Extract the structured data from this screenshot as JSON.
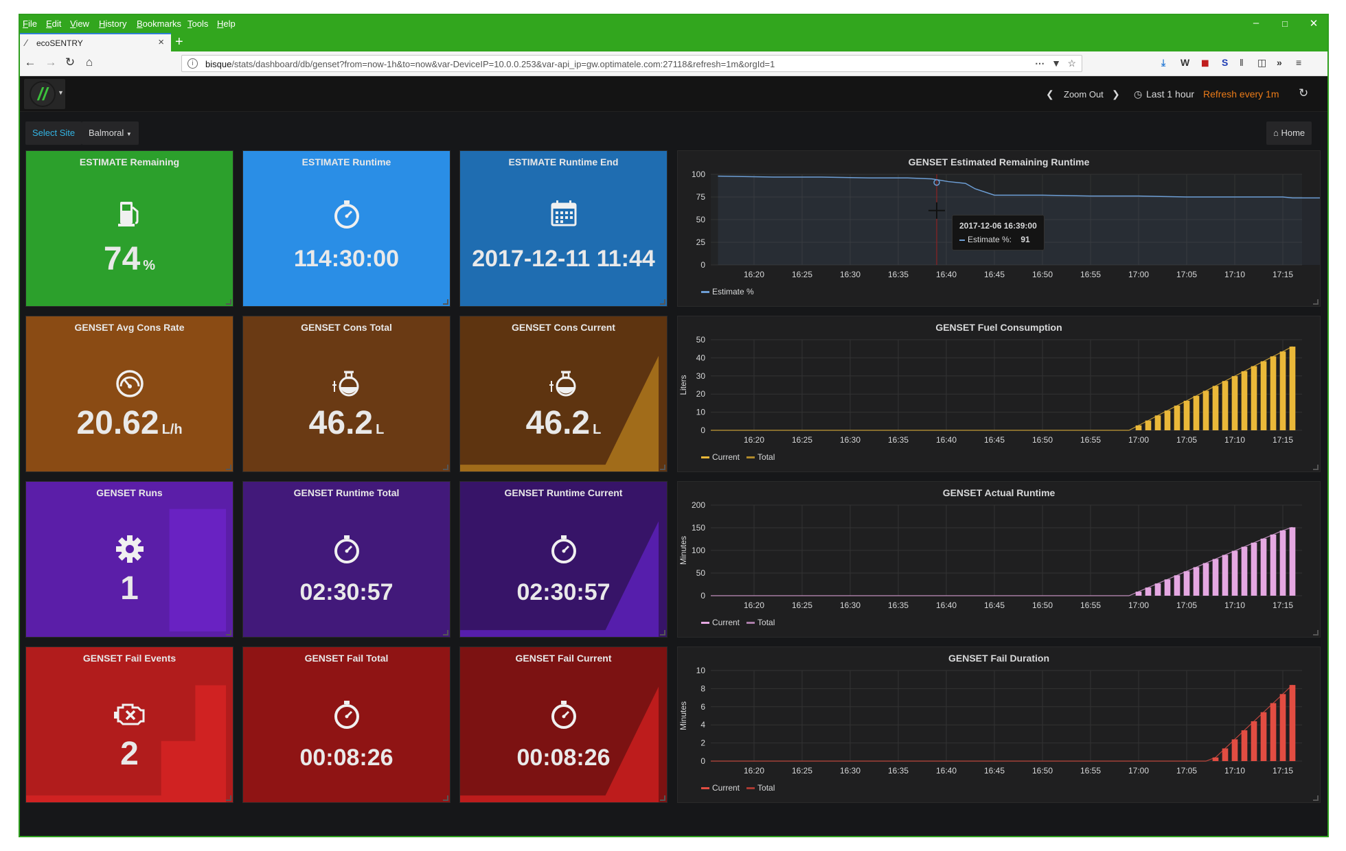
{
  "browser": {
    "menu": [
      "File",
      "Edit",
      "View",
      "History",
      "Bookmarks",
      "Tools",
      "Help"
    ],
    "tab_title": "ecoSENTRY",
    "url_host": "bisque",
    "url_path": "/stats/dashboard/db/genset?from=now-1h&to=now&var-DeviceIP=10.0.0.253&var-api_ip=gw.optimatele.com:27118&refresh=1m&orgId=1",
    "colors": {
      "frame": "#32a61e"
    }
  },
  "topbar": {
    "zoom_out": "Zoom Out",
    "time_range": "Last 1 hour",
    "refresh": "Refresh every 1m"
  },
  "vars": {
    "label": "Select Site",
    "value": "Balmoral",
    "home": "Home"
  },
  "stat_panels": [
    {
      "title": "ESTIMATE Remaining",
      "value": "74",
      "unit": "%",
      "icon": "fuel-pump-icon",
      "color": "#2ca02c",
      "spark": "none"
    },
    {
      "title": "ESTIMATE Runtime",
      "value": "114:30:00",
      "unit": "",
      "icon": "stopwatch-icon",
      "color": "#2a8ee6",
      "spark": "none"
    },
    {
      "title": "ESTIMATE Runtime End",
      "value": "2017-12-11 11:44",
      "unit": "",
      "icon": "calendar-icon",
      "color": "#1f6db1",
      "spark": "none"
    },
    {
      "title": "GENSET Avg Cons Rate",
      "value": "20.62",
      "unit": "L/h",
      "icon": "gauge-icon",
      "color": "#8a4b14",
      "spark": "none"
    },
    {
      "title": "GENSET Cons Total",
      "value": "46.2",
      "unit": "L",
      "icon": "flask-icon",
      "color": "#6a3a14",
      "spark": "none"
    },
    {
      "title": "GENSET Cons Current",
      "value": "46.2",
      "unit": "L",
      "icon": "flask-icon",
      "color": "#5e3410",
      "spark": "ramp",
      "spark_color": "#a8721c"
    },
    {
      "title": "GENSET Runs",
      "value": "1",
      "unit": "",
      "icon": "gear-icon",
      "color": "#5b1ea8",
      "spark": "block",
      "spark_color": "#6a22c4"
    },
    {
      "title": "GENSET Runtime Total",
      "value": "02:30:57",
      "unit": "",
      "icon": "stopwatch-icon",
      "color": "#42197a",
      "spark": "none"
    },
    {
      "title": "GENSET Runtime Current",
      "value": "02:30:57",
      "unit": "",
      "icon": "stopwatch-icon",
      "color": "#371468",
      "spark": "ramp",
      "spark_color": "#5a1fb4"
    },
    {
      "title": "GENSET Fail Events",
      "value": "2",
      "unit": "",
      "icon": "engine-icon",
      "color": "#b11c1c",
      "spark": "step",
      "spark_color": "#d42424"
    },
    {
      "title": "GENSET Fail Total",
      "value": "00:08:26",
      "unit": "",
      "icon": "stopwatch-icon",
      "color": "#8f1414",
      "spark": "none"
    },
    {
      "title": "GENSET Fail Current",
      "value": "00:08:26",
      "unit": "",
      "icon": "stopwatch-icon",
      "color": "#7c1212",
      "spark": "ramp",
      "spark_color": "#c41e1e"
    }
  ],
  "chart_data": [
    {
      "type": "line",
      "title": "GENSET Estimated Remaining Runtime",
      "xlabel": "",
      "ylabel": "",
      "xticks": [
        "16:20",
        "16:25",
        "16:30",
        "16:35",
        "16:40",
        "16:45",
        "16:50",
        "16:55",
        "17:00",
        "17:05",
        "17:10",
        "17:15"
      ],
      "ylim": [
        0,
        100
      ],
      "yticks": [
        0,
        25,
        50,
        75,
        100
      ],
      "color": "#6d9ed5",
      "fill": true,
      "series": [
        {
          "name": "Estimate %",
          "x": [
            16.25,
            22,
            27,
            32,
            36,
            38.5,
            40.2,
            42,
            43,
            45,
            50,
            55,
            60,
            65,
            70,
            75,
            76,
            80,
            85,
            90,
            91.5
          ],
          "values": [
            98,
            97,
            97,
            96,
            96,
            95,
            92,
            90,
            84,
            77,
            77,
            76,
            76,
            75,
            75,
            75,
            74,
            74,
            74,
            74,
            74
          ]
        }
      ],
      "tooltip": {
        "time": "2017-12-06 16:39:00",
        "label": "Estimate %:",
        "value": "91"
      }
    },
    {
      "type": "bar",
      "title": "GENSET Fuel Consumption",
      "xlabel": "",
      "ylabel": "Liters",
      "xticks": [
        "16:20",
        "16:25",
        "16:30",
        "16:35",
        "16:40",
        "16:45",
        "16:50",
        "16:55",
        "17:00",
        "17:05",
        "17:10",
        "17:15"
      ],
      "ylim": [
        0,
        50
      ],
      "yticks": [
        0,
        10,
        20,
        30,
        40,
        50
      ],
      "color": "#eab839",
      "series": [
        {
          "name": "Current",
          "x": [
            60,
            61,
            62,
            63,
            64,
            65,
            66,
            67,
            68,
            69,
            70,
            71,
            72,
            73,
            74,
            75,
            76
          ],
          "values": [
            2.7,
            5.4,
            8.2,
            10.9,
            13.6,
            16.3,
            19,
            21.8,
            24.5,
            27.2,
            29.9,
            32.6,
            35.4,
            38.1,
            40.8,
            43.5,
            46.2
          ]
        },
        {
          "name": "Total",
          "x": [],
          "values": []
        }
      ]
    },
    {
      "type": "bar",
      "title": "GENSET Actual Runtime",
      "xlabel": "",
      "ylabel": "Minutes",
      "xticks": [
        "16:20",
        "16:25",
        "16:30",
        "16:35",
        "16:40",
        "16:45",
        "16:50",
        "16:55",
        "17:00",
        "17:05",
        "17:10",
        "17:15"
      ],
      "ylim": [
        0,
        200
      ],
      "yticks": [
        0,
        50,
        100,
        150,
        200
      ],
      "color": "#e5a8e2",
      "series": [
        {
          "name": "Current",
          "x": [
            60,
            61,
            62,
            63,
            64,
            65,
            66,
            67,
            68,
            69,
            70,
            71,
            72,
            73,
            74,
            75,
            76
          ],
          "values": [
            9,
            18,
            27,
            36,
            45,
            54,
            63,
            72,
            81,
            90,
            99,
            108,
            117,
            126,
            135,
            144,
            151
          ]
        },
        {
          "name": "Total",
          "x": [],
          "values": []
        }
      ]
    },
    {
      "type": "bar",
      "title": "GENSET Fail Duration",
      "xlabel": "",
      "ylabel": "Minutes",
      "xticks": [
        "16:20",
        "16:25",
        "16:30",
        "16:35",
        "16:40",
        "16:45",
        "16:50",
        "16:55",
        "17:00",
        "17:05",
        "17:10",
        "17:15"
      ],
      "ylim": [
        0,
        10
      ],
      "yticks": [
        0,
        2,
        4,
        6,
        8,
        10
      ],
      "color": "#e24d42",
      "series": [
        {
          "name": "Current",
          "x": [
            68,
            69,
            70,
            71,
            72,
            73,
            74,
            75,
            76
          ],
          "values": [
            0.4,
            1.4,
            2.4,
            3.4,
            4.4,
            5.4,
            6.4,
            7.4,
            8.4
          ]
        },
        {
          "name": "Total",
          "x": [],
          "values": []
        }
      ]
    }
  ]
}
